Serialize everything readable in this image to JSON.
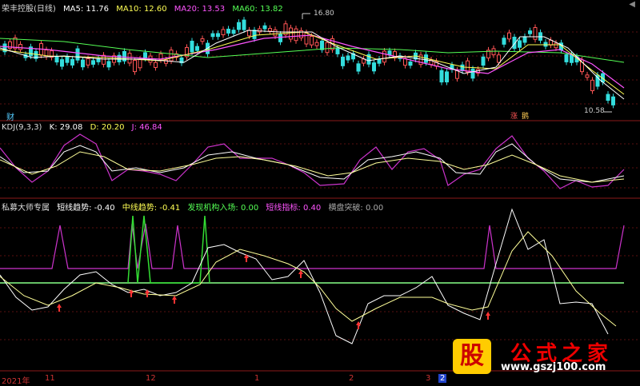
{
  "window": {
    "title": "荣丰控股(日线)",
    "corner": "◀"
  },
  "main": {
    "ma": [
      {
        "label": "MA5: 11.76",
        "color": "#ffffff"
      },
      {
        "label": "MA10: 12.60",
        "color": "#ffff55"
      },
      {
        "label": "MA20: 13.53",
        "color": "#ff55ff"
      },
      {
        "label": "MA60: 13.82",
        "color": "#55ff55"
      }
    ],
    "high_label": "16.80",
    "low_label": "10.58",
    "cai": "财",
    "tags": [
      "涨",
      "鹅"
    ]
  },
  "kdj": {
    "name": "KDJ(9,3,3)",
    "k": "K: 29.08",
    "d": "D: 20.20",
    "j": "J: 46.84"
  },
  "indicator": {
    "name": "私募大师专属",
    "items": [
      {
        "label": "短线趋势: -0.40",
        "color": "#ffffff"
      },
      {
        "label": "中线趋势: -0.41",
        "color": "#ffff55"
      },
      {
        "label": "发现机构入场: 0.00",
        "color": "#55ff55"
      },
      {
        "label": "短线指标: 0.40",
        "color": "#ff55ff"
      },
      {
        "label": "横盘突破: 0.00",
        "color": "#aaaaaa"
      }
    ]
  },
  "xaxis": [
    "2021年",
    "11",
    "12",
    "1",
    "2",
    "3",
    "2"
  ],
  "watermark": {
    "glyph": "股",
    "site": "公式之家",
    "url": "www.gszj100.com"
  }
}
